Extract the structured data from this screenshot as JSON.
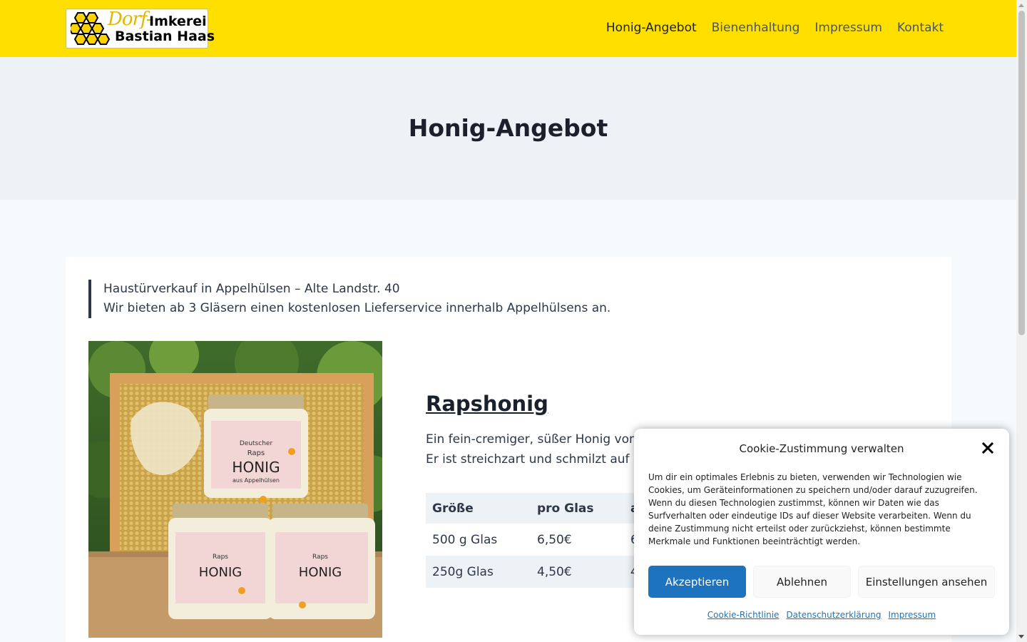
{
  "header": {
    "logo": {
      "line1_script": "Dorf-",
      "line1_bold": "Imkerei",
      "line2": "Bastian Haas"
    },
    "nav": [
      {
        "label": "Honig-Angebot",
        "active": true
      },
      {
        "label": "Bienenhaltung",
        "active": false
      },
      {
        "label": "Impressum",
        "active": false
      },
      {
        "label": "Kontakt",
        "active": false
      }
    ],
    "bg_color": "#ffdf00"
  },
  "hero": {
    "title": "Honig-Angebot"
  },
  "main": {
    "notice": {
      "line1": "Haustürverkauf in Appelhülsen – Alte Landstr. 40",
      "line2": "Wir bieten ab 3 Gläsern einen kostenlosen Lieferservice innerhalb Appelhülsens an."
    },
    "product": {
      "title": "Rapshonig",
      "desc_line1": "Ein fein-cremiger, süßer Honig von",
      "desc_line2": "Er ist streichzart und schmilzt auf",
      "table": {
        "headers": [
          "Größe",
          "pro Glas",
          "a"
        ],
        "rows": [
          [
            "500 g Glas",
            "6,50€",
            "6"
          ],
          [
            "250g Glas",
            "4,50€",
            "4"
          ]
        ]
      },
      "jar_labels": {
        "l1": "Deutscher",
        "l2": "Raps",
        "l3": "HONIG",
        "l4": "aus Appelhülsen"
      }
    }
  },
  "cookie": {
    "title": "Cookie-Zustimmung verwalten",
    "text": "Um dir ein optimales Erlebnis zu bieten, verwenden wir Technologien wie Cookies, um Geräteinformationen zu speichern und/oder darauf zuzugreifen. Wenn du diesen Technologien zustimmst, können wir Daten wie das Surfverhalten oder eindeutige IDs auf dieser Website verarbeiten. Wenn du deine Zustimmung nicht erteilst oder zurückziehst, können bestimmte Merkmale und Funktionen beeinträchtigt werden.",
    "accept": "Akzeptieren",
    "deny": "Ablehnen",
    "settings": "Einstellungen ansehen",
    "links": [
      "Cookie-Richtlinie",
      "Datenschutzerklärung",
      "Impressum"
    ],
    "accent_color": "#1e73be"
  }
}
